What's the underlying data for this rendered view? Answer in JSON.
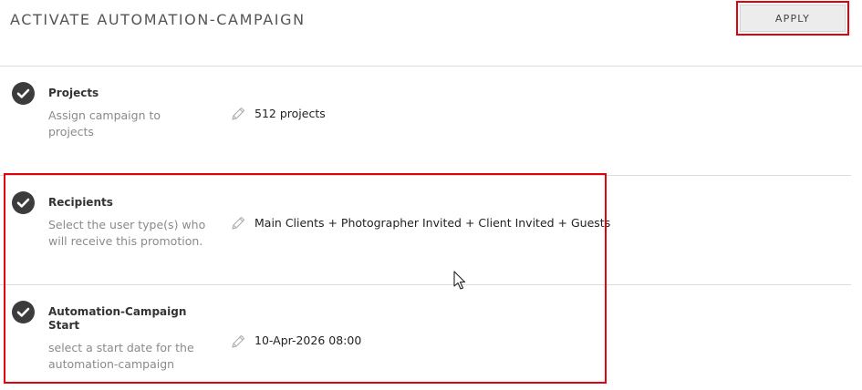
{
  "header": {
    "title": "ACTIVATE AUTOMATION-CAMPAIGN",
    "apply_label": "APPLY"
  },
  "steps": [
    {
      "title": "Projects",
      "description": "Assign campaign to projects",
      "value": "512 projects",
      "completed": true
    },
    {
      "title": "Recipients",
      "description": "Select the user type(s) who will receive this promotion.",
      "value": "Main Clients + Photographer Invited + Client Invited + Guests",
      "completed": true
    },
    {
      "title": "Automation-Campaign Start",
      "description": "select a start date for the automation-campaign",
      "value": "10-Apr-2026 08:00",
      "completed": true
    }
  ],
  "colors": {
    "highlight": "#e3000f",
    "check_bg": "#3c3c3c",
    "title_text": "#555555",
    "muted_text": "#8a8a8a"
  },
  "icons": {
    "step_status": "check-circle-icon",
    "edit": "pencil-icon",
    "pointer": "mouse-cursor-icon"
  }
}
